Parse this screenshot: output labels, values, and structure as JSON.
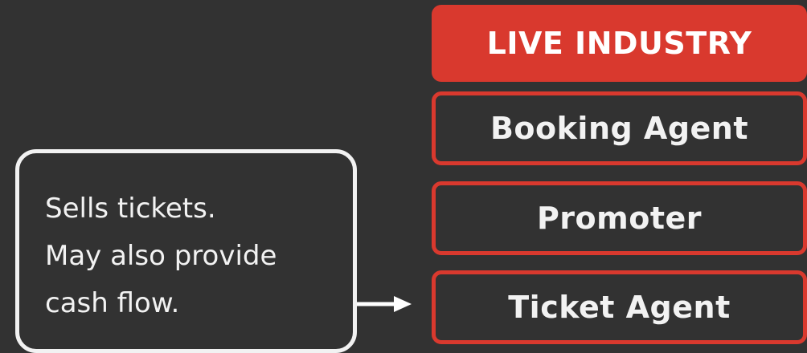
{
  "diagram": {
    "header": "LIVE INDUSTRY",
    "roles": [
      "Booking Agent",
      "Promoter",
      "Ticket Agent"
    ],
    "callout": {
      "lines": [
        "Sells tickets.",
        "May also provide",
        "cash flow."
      ]
    }
  },
  "colors": {
    "background": "#323232",
    "accent": "#d9392e",
    "text": "#f2f2f2"
  }
}
